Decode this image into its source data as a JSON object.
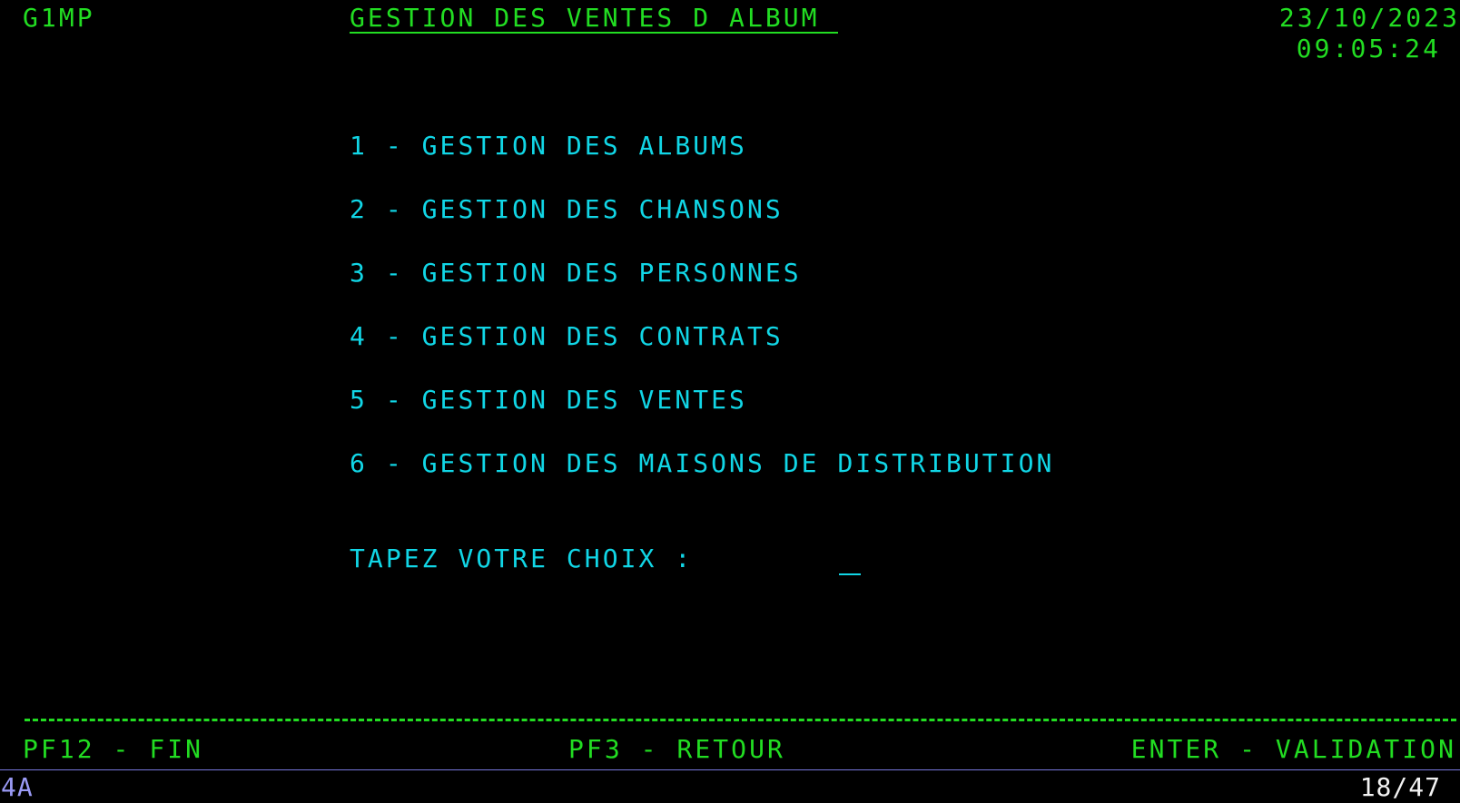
{
  "header": {
    "screen_id": "G1MP",
    "title": "GESTION DES VENTES D ALBUM ",
    "date": "23/10/2023",
    "time": "09:05:24"
  },
  "menu": {
    "items": [
      {
        "label": "1 - GESTION DES ALBUMS"
      },
      {
        "label": "2 - GESTION DES CHANSONS"
      },
      {
        "label": "3 - GESTION DES PERSONNES"
      },
      {
        "label": "4 - GESTION DES CONTRATS"
      },
      {
        "label": "5 - GESTION DES VENTES"
      },
      {
        "label": "6 - GESTION DES MAISONS DE DISTRIBUTION"
      }
    ],
    "prompt": "TAPEZ VOTRE CHOIX :",
    "choice_value": ""
  },
  "footer": {
    "pf12": "PF12 - FIN",
    "pf3": "PF3 - RETOUR",
    "enter": "ENTER - VALIDATION"
  },
  "status": {
    "session": "4A",
    "cursor": "18/47"
  },
  "colors": {
    "background": "#000000",
    "field_green": "#22dd22",
    "menu_cyan": "#11d6e6",
    "status_blue": "#9a9af5",
    "status_white": "#f2f2f2"
  }
}
